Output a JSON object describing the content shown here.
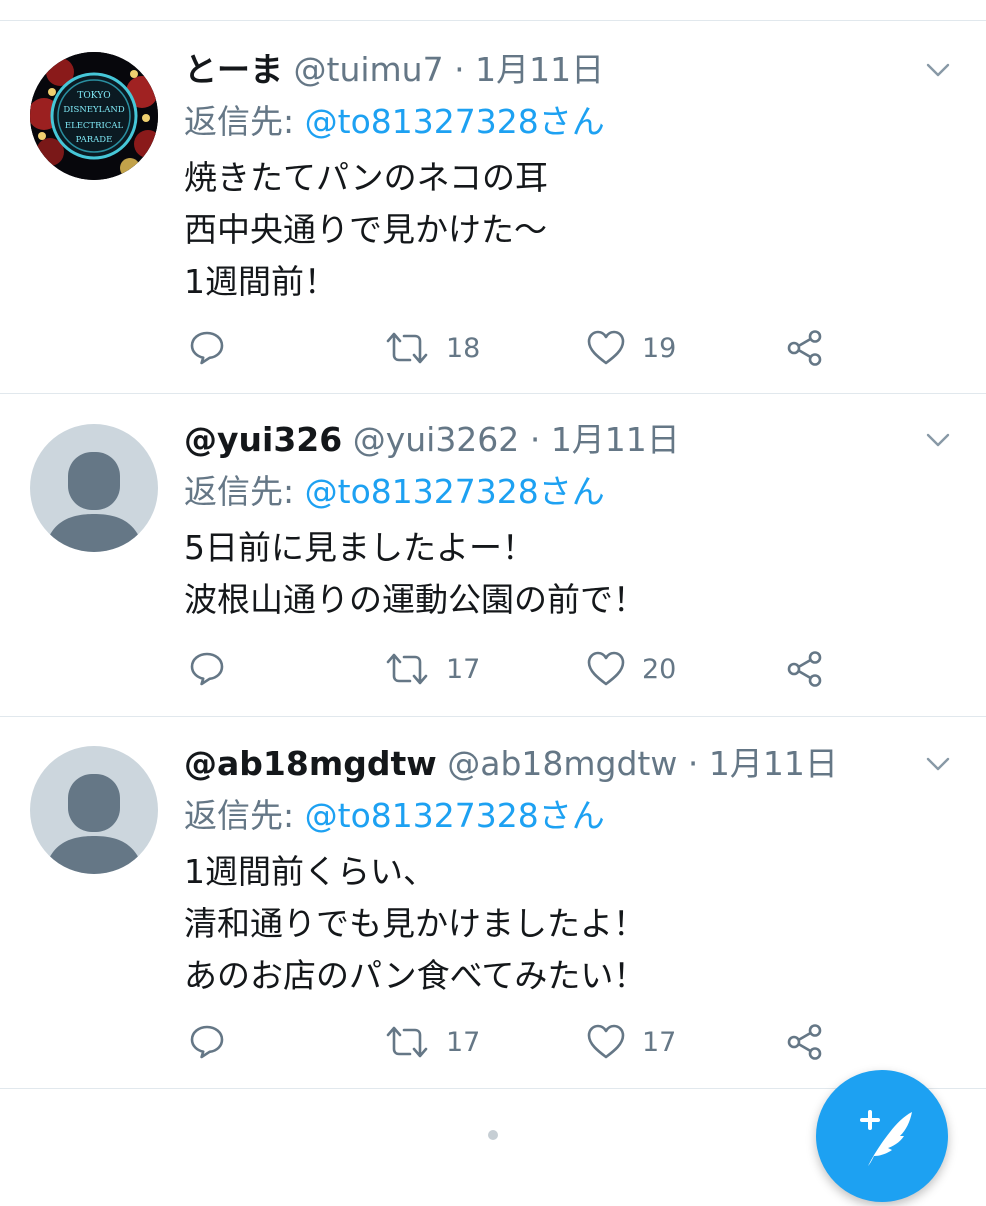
{
  "tweets": [
    {
      "display_name": "とーま",
      "handle": "@tuimu7",
      "separator": "·",
      "date": "1月11日",
      "reply_label": "返信先:",
      "reply_to": "@to81327328さん",
      "lines": [
        "焼きたてパンのネコの耳",
        "西中央通りで見かけた〜",
        "1週間前！"
      ],
      "retweets": "18",
      "likes": "19",
      "avatar_text": [
        "TOKYO",
        "DISNEYLAND",
        "ELECTRICAL",
        "PARADE"
      ]
    },
    {
      "display_name": "@yui326",
      "handle": "@yui3262",
      "separator": "·",
      "date": "1月11日",
      "reply_label": "返信先:",
      "reply_to": "@to81327328さん",
      "lines": [
        "5日前に見ましたよー！",
        "波根山通りの運動公園の前で！"
      ],
      "retweets": "17",
      "likes": "20"
    },
    {
      "display_name": "@ab18mgdtw",
      "handle": "@ab18mgdtw",
      "separator": "·",
      "date": "1月11日",
      "reply_label": "返信先:",
      "reply_to": "@to81327328さん",
      "lines": [
        "1週間前くらい、",
        "清和通りでも見かけましたよ！",
        "あのお店のパン食べてみたい！"
      ],
      "retweets": "17",
      "likes": "17"
    }
  ],
  "colors": {
    "accent": "#1da1f2",
    "secondary_text": "#657786",
    "divider": "#e1e8ed",
    "default_avatar_bg": "#ccd6dd",
    "default_avatar_figure": "#657786"
  },
  "icons": {
    "reply": "reply-icon",
    "retweet": "retweet-icon",
    "like": "heart-icon",
    "share": "share-icon",
    "caret": "chevron-down-icon",
    "compose": "compose-tweet-icon"
  }
}
